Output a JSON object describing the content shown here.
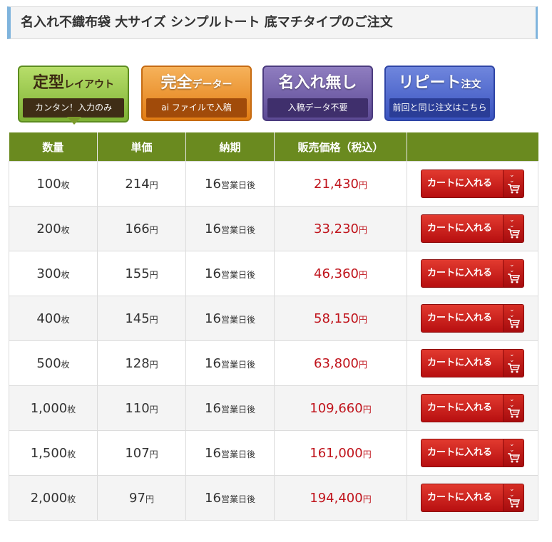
{
  "page": {
    "title": "名入れ不織布袋 大サイズ シンプルトート 底マチタイプのご注文"
  },
  "tabs": [
    {
      "main": "定型",
      "main_small": "レイアウト",
      "sub": "カンタン！入力のみ",
      "color": "#8cbf3f"
    },
    {
      "main": "完全",
      "main_small": "データー",
      "sub": "ai ファイルで入稿",
      "color": "#e98a22"
    },
    {
      "main": "名入れ無し",
      "main_small": "",
      "sub": "入稿データ不要",
      "color": "#6b58a6"
    },
    {
      "main": "リピート",
      "main_small": "注文",
      "sub": "前回と同じ注文はこちら",
      "color": "#4a63cc"
    }
  ],
  "table": {
    "headers": [
      "数量",
      "単価",
      "納期",
      "販売価格（税込）",
      ""
    ],
    "qty_unit": "枚",
    "price_unit": "円",
    "delivery_unit": "営業日後",
    "cart_label": "カートに入れる",
    "rows": [
      {
        "qty": "100",
        "unit_price": "214",
        "days": "16",
        "total": "21,430"
      },
      {
        "qty": "200",
        "unit_price": "166",
        "days": "16",
        "total": "33,230"
      },
      {
        "qty": "300",
        "unit_price": "155",
        "days": "16",
        "total": "46,360"
      },
      {
        "qty": "400",
        "unit_price": "145",
        "days": "16",
        "total": "58,150"
      },
      {
        "qty": "500",
        "unit_price": "128",
        "days": "16",
        "total": "63,800"
      },
      {
        "qty": "1,000",
        "unit_price": "110",
        "days": "16",
        "total": "109,660"
      },
      {
        "qty": "1,500",
        "unit_price": "107",
        "days": "16",
        "total": "161,000"
      },
      {
        "qty": "2,000",
        "unit_price": "97",
        "days": "16",
        "total": "194,400"
      }
    ]
  },
  "colors": {
    "header_bg": "#6a8a1f",
    "price_text": "#c0141c",
    "cart_button": "#cf1f1c"
  }
}
